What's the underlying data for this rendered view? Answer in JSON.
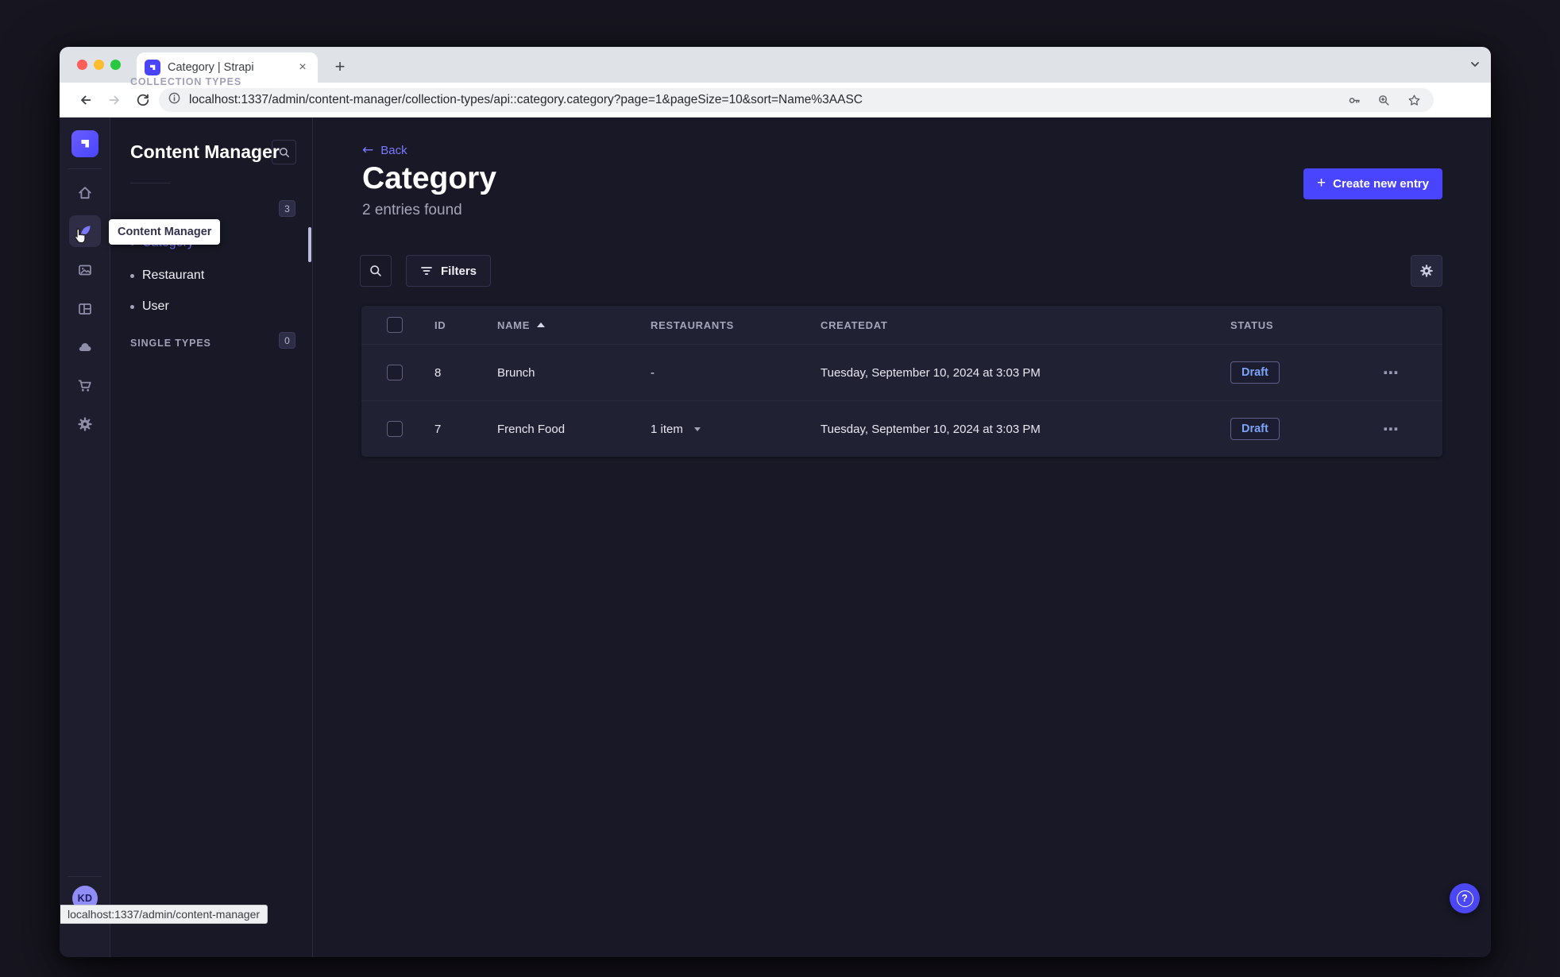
{
  "browser": {
    "tab_title": "Category | Strapi",
    "url": "localhost:1337/admin/content-manager/collection-types/api::category.category?page=1&pageSize=10&sort=Name%3AASC",
    "status_bubble": "localhost:1337/admin/content-manager"
  },
  "rail": {
    "avatar_initials": "KD"
  },
  "sidebar": {
    "title": "Content Manager",
    "tooltip": "Content Manager",
    "collection_header": "COLLECTION TYPES",
    "collection_count": "3",
    "items": [
      {
        "label": "Category",
        "active": true
      },
      {
        "label": "Restaurant",
        "active": false
      },
      {
        "label": "User",
        "active": false
      }
    ],
    "single_header": "SINGLE TYPES",
    "single_count": "0"
  },
  "main": {
    "back": "Back",
    "title": "Category",
    "subtitle": "2 entries found",
    "create": "Create new entry",
    "filters": "Filters",
    "table": {
      "headers": {
        "id": "ID",
        "name": "NAME",
        "restaurants": "RESTAURANTS",
        "createdat": "CREATEDAT",
        "status": "STATUS"
      },
      "rows": [
        {
          "id": "8",
          "name": "Brunch",
          "restaurants": "-",
          "createdat": "Tuesday, September 10, 2024 at 3:03 PM",
          "status": "Draft"
        },
        {
          "id": "7",
          "name": "French Food",
          "restaurants": "1 item",
          "createdat": "Tuesday, September 10, 2024 at 3:03 PM",
          "status": "Draft"
        }
      ]
    },
    "help": "?"
  },
  "icons": {
    "close": "×",
    "new_tab": "+",
    "menu_dots": "⋮",
    "row_menu": "⋯",
    "back_arrow": "←",
    "plus": "+"
  },
  "colors": {
    "primary": "#4945ff",
    "link": "#7b79ff",
    "draft_text": "#7ba4f8",
    "app_bg": "#181826",
    "card_bg": "#212134",
    "traffic_red": "#ff5f57",
    "traffic_yellow": "#febc2e",
    "traffic_green": "#28c840"
  }
}
